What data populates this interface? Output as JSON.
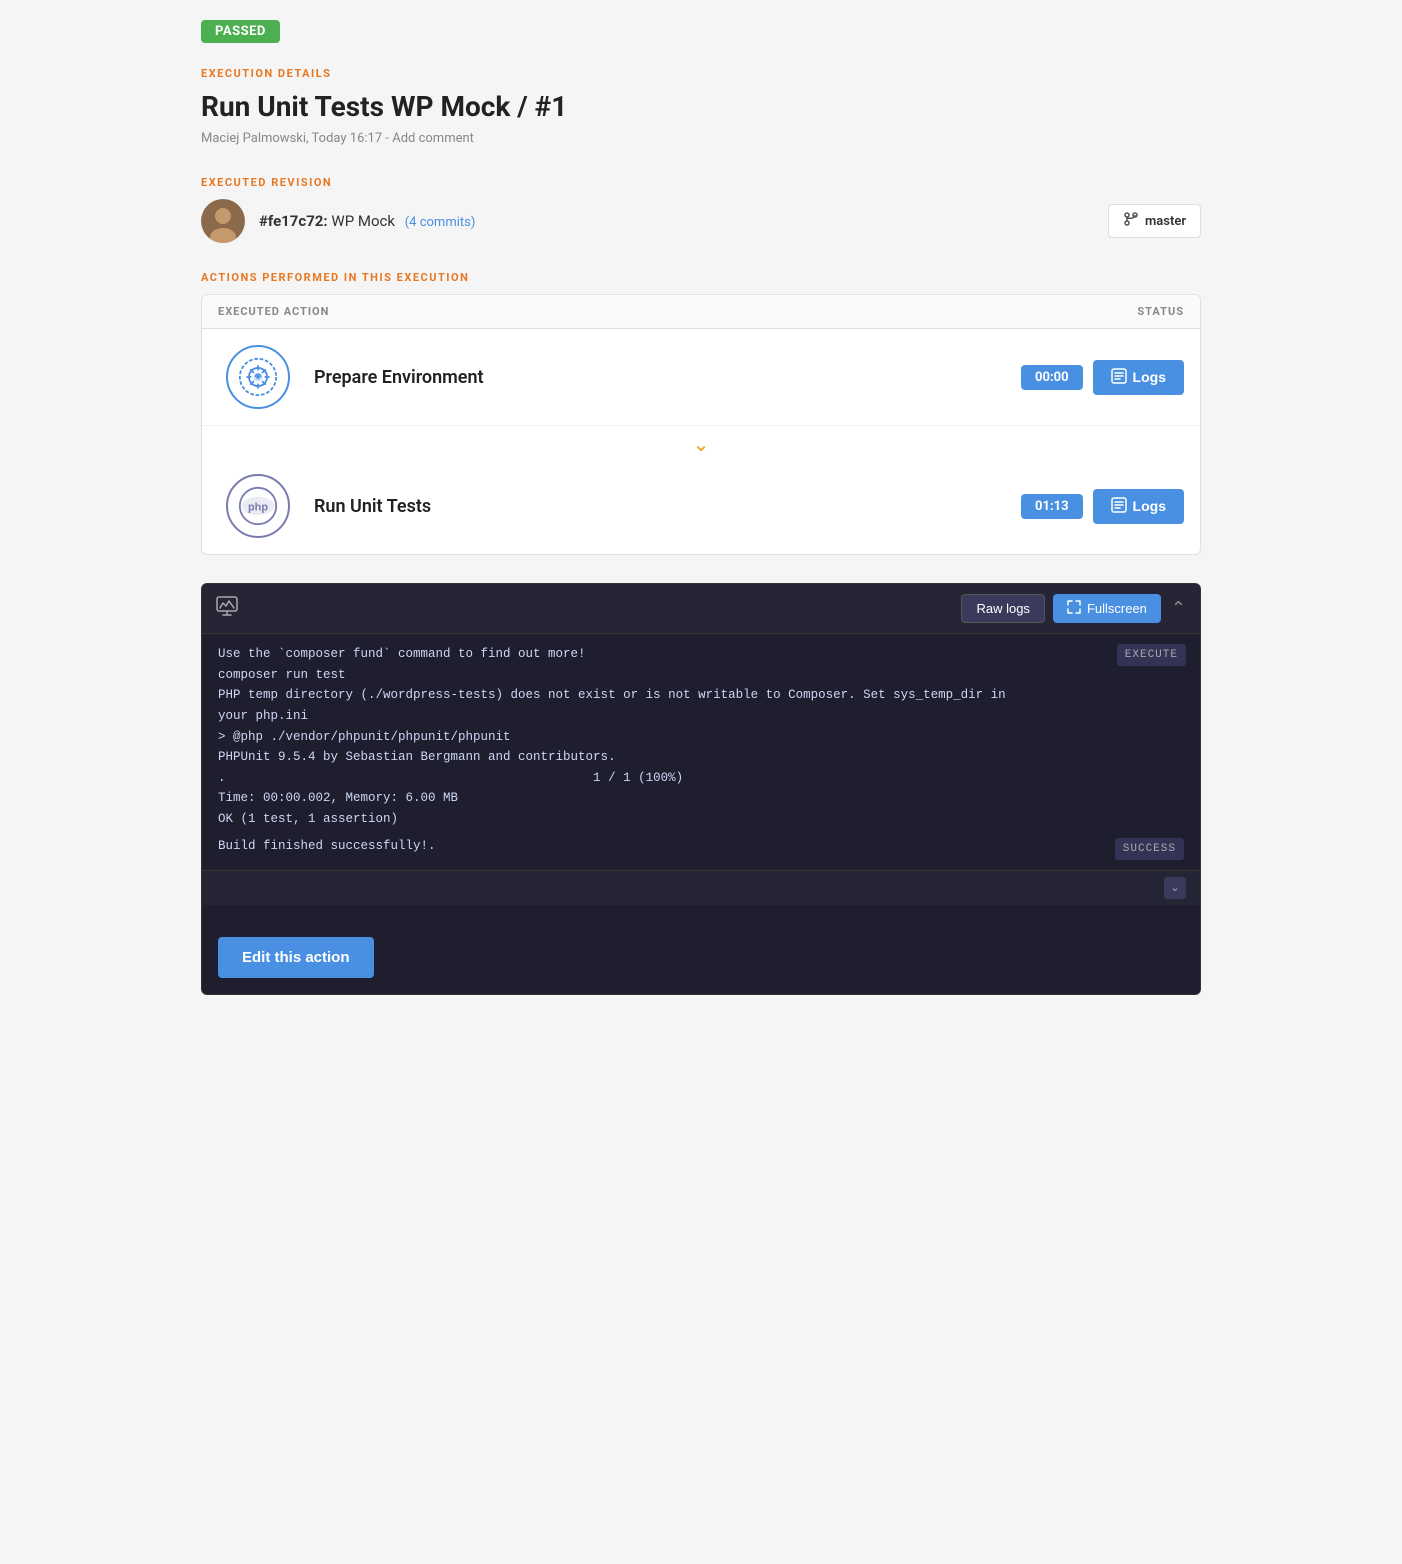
{
  "status_badge": "PASSED",
  "execution_details_label": "EXECUTION DETAILS",
  "page_title": "Run Unit Tests WP Mock / #1",
  "page_meta": "Maciej Palmowski, Today 16:17",
  "add_comment_label": "Add comment",
  "executed_revision_label": "EXECUTED REVISION",
  "revision_hash": "#fe17c72:",
  "revision_name": "WP Mock",
  "commits_label": "(4 commits)",
  "branch_label": "master",
  "actions_label": "ACTIONS PERFORMED IN THIS EXECUTION",
  "col_action_label": "EXECUTED ACTION",
  "col_status_label": "STATUS",
  "actions": [
    {
      "name": "Prepare Environment",
      "time": "00:00",
      "type": "gear"
    },
    {
      "name": "Run Unit Tests",
      "time": "01:13",
      "type": "php"
    }
  ],
  "logs_btn_label": "Logs",
  "raw_logs_label": "Raw logs",
  "fullscreen_label": "Fullscreen",
  "log_lines": [
    {
      "text": "Use the `composer fund` command to find out more!",
      "class": "log-normal"
    },
    {
      "text": "composer run test",
      "class": "log-green"
    },
    {
      "text": "PHP temp directory (./wordpress-tests) does not exist or is not writable to Composer. Set sys_temp_dir in\nyour php.ini",
      "class": "log-normal"
    },
    {
      "text": "> @php ./vendor/phpunit/phpunit/phpunit",
      "class": "log-normal"
    },
    {
      "text": "PHPUnit 9.5.4 by Sebastian Bergmann and contributors.",
      "class": "log-normal"
    },
    {
      "text": ".                                                    1 / 1 (100%)",
      "class": "log-normal"
    },
    {
      "text": "Time: 00:00.002, Memory: 6.00 MB",
      "class": "log-normal"
    },
    {
      "text": "OK (1 test, 1 assertion)",
      "class": "log-normal"
    },
    {
      "text": "Build finished successfully!.",
      "class": "log-green"
    }
  ],
  "execute_tag": "EXECUTE",
  "success_tag": "SUCCESS",
  "edit_action_label": "Edit this action"
}
